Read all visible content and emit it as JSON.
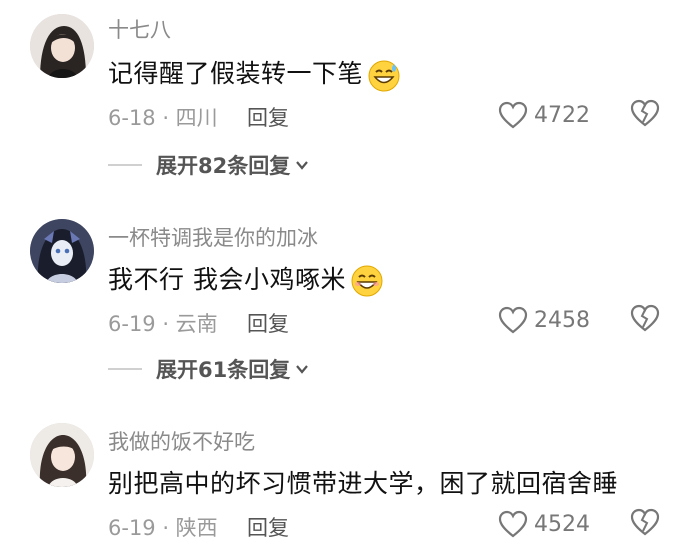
{
  "comments": [
    {
      "username": "十七八",
      "text": "记得醒了假装转一下笔",
      "emoji": "sweat-smile-emoji",
      "meta": "6-18 · 四川",
      "reply_label": "回复",
      "likes": "4722",
      "expand_label": "展开82条回复"
    },
    {
      "username": "一杯特调我是你的加冰",
      "text": "我不行 我会小鸡啄米",
      "emoji": "grin-emoji",
      "meta": "6-19 · 云南",
      "reply_label": "回复",
      "likes": "2458",
      "expand_label": "展开61条回复"
    },
    {
      "username": "我做的饭不好吃",
      "text": "别把高中的坏习惯带进大学，困了就回宿舍睡",
      "meta": "6-19 · 陕西",
      "reply_label": "回复",
      "likes": "4524"
    }
  ]
}
